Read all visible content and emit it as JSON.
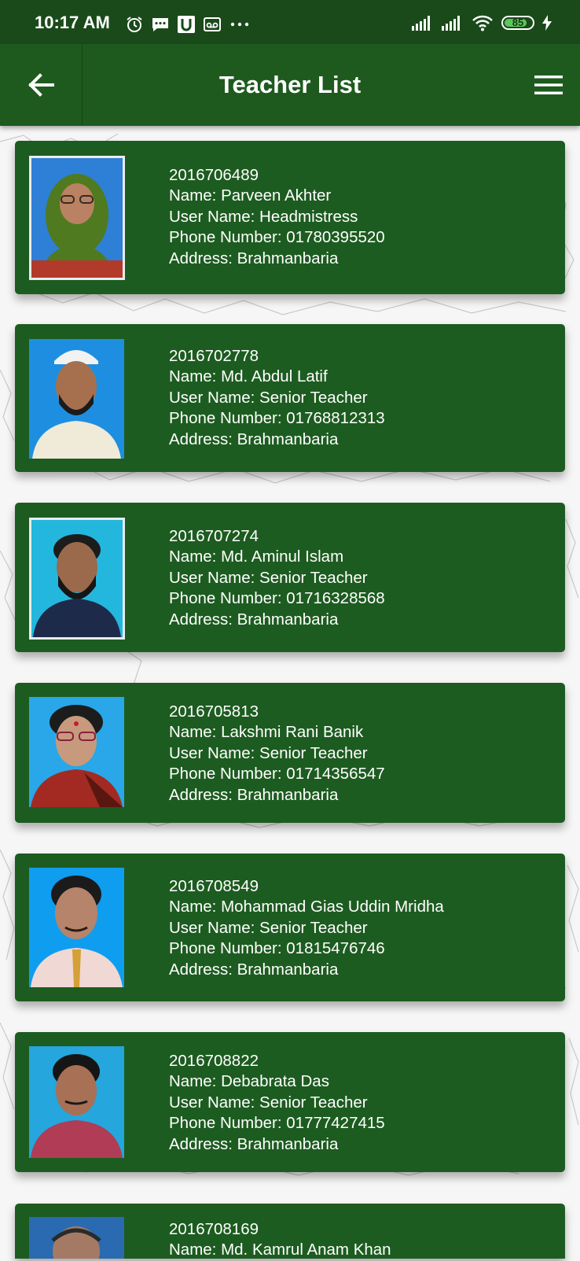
{
  "status_bar": {
    "time": "10:17 AM",
    "battery_level": "85",
    "left_icons": [
      "alarm-icon",
      "message-icon",
      "u-app-icon",
      "voicemail-icon",
      "more-icon"
    ],
    "right_icons": [
      "signal-icon",
      "signal-icon",
      "wifi-icon",
      "battery-icon",
      "charging-icon"
    ]
  },
  "app_bar": {
    "title": "Teacher List",
    "back_icon": "arrow-left-icon",
    "menu_icon": "hamburger-menu-icon"
  },
  "colors": {
    "status_bar": "#1a4a1a",
    "app_bar": "#1e5a1e",
    "card": "#1d5c20",
    "text": "#ffffff",
    "page_background": "#f6f6f6"
  },
  "teachers": [
    {
      "id": "2016706489",
      "name": "Name: Parveen Akhter",
      "user_name": "User Name: Headmistress",
      "phone": "Phone Number: 01780395520",
      "address": "Address: Brahmanbaria"
    },
    {
      "id": "2016702778",
      "name": "Name: Md. Abdul Latif",
      "user_name": "User Name: Senior Teacher",
      "phone": "Phone Number: 01768812313",
      "address": "Address: Brahmanbaria"
    },
    {
      "id": "2016707274",
      "name": "Name: Md. Aminul Islam",
      "user_name": "User Name: Senior Teacher",
      "phone": "Phone Number: 01716328568",
      "address": "Address: Brahmanbaria"
    },
    {
      "id": "2016705813",
      "name": "Name: Lakshmi Rani Banik",
      "user_name": "User Name: Senior Teacher",
      "phone": "Phone Number: 01714356547",
      "address": "Address: Brahmanbaria"
    },
    {
      "id": "2016708549",
      "name": "Name: Mohammad Gias Uddin Mridha",
      "user_name": "User Name: Senior Teacher",
      "phone": "Phone Number: 01815476746",
      "address": "Address: Brahmanbaria"
    },
    {
      "id": "2016708822",
      "name": "Name: Debabrata Das",
      "user_name": "User Name: Senior Teacher",
      "phone": "Phone Number: 01777427415",
      "address": "Address: Brahmanbaria"
    },
    {
      "id": "2016708169",
      "name": "Name: Md. Kamrul Anam Khan"
    }
  ]
}
